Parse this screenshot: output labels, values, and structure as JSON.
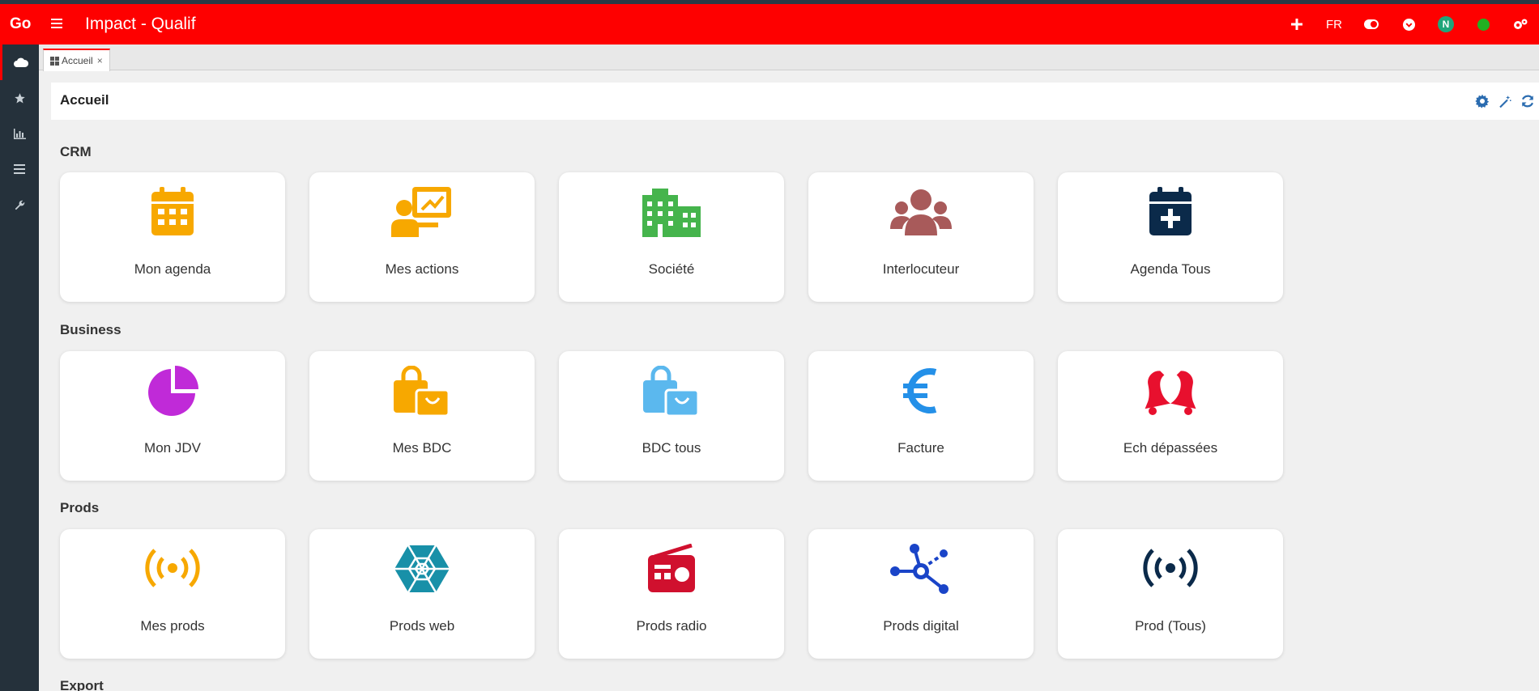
{
  "header": {
    "logo": "Go",
    "title": "Impact - Qualif",
    "language": "FR",
    "avatar_initial": "N",
    "color": "#fe0000"
  },
  "sidebar": {
    "items": [
      {
        "icon": "cloud-icon"
      },
      {
        "icon": "star-icon"
      },
      {
        "icon": "bar-chart-icon"
      },
      {
        "icon": "list-icon"
      },
      {
        "icon": "wrench-icon"
      }
    ]
  },
  "tabs": [
    {
      "label": "Accueil",
      "icon": "grid-icon",
      "close": "×"
    }
  ],
  "page": {
    "title": "Accueil"
  },
  "sections": [
    {
      "title": "CRM",
      "cards": [
        {
          "label": "Mon agenda",
          "icon": "calendar-icon",
          "color": "#f7a800"
        },
        {
          "label": "Mes actions",
          "icon": "presenter-chart-icon",
          "color": "#f7a800"
        },
        {
          "label": "Société",
          "icon": "building-icon",
          "color": "#45b44c"
        },
        {
          "label": "Interlocuteur",
          "icon": "users-icon",
          "color": "#a85a5a"
        },
        {
          "label": "Agenda Tous",
          "icon": "calendar-plus-icon",
          "color": "#0b2a4a"
        }
      ]
    },
    {
      "title": "Business",
      "cards": [
        {
          "label": "Mon JDV",
          "icon": "pie-chart-icon",
          "color": "#c02ad8"
        },
        {
          "label": "Mes BDC",
          "icon": "shopping-bags-icon",
          "color": "#f7a800"
        },
        {
          "label": "BDC tous",
          "icon": "shopping-bags-icon",
          "color": "#5bb8ee"
        },
        {
          "label": "Facture",
          "icon": "euro-icon",
          "color": "#2490e8"
        },
        {
          "label": "Ech dépassées",
          "icon": "bells-icon",
          "color": "#e8102e"
        }
      ]
    },
    {
      "title": "Prods",
      "cards": [
        {
          "label": "Mes prods",
          "icon": "broadcast-icon",
          "color": "#f7a800"
        },
        {
          "label": "Prods web",
          "icon": "spider-web-icon",
          "color": "#1890a8"
        },
        {
          "label": "Prods radio",
          "icon": "radio-icon",
          "color": "#d0102e"
        },
        {
          "label": "Prods digital",
          "icon": "network-icon",
          "color": "#1a44c8"
        },
        {
          "label": "Prod (Tous)",
          "icon": "broadcast-icon",
          "color": "#0b2a4a"
        }
      ]
    },
    {
      "title": "Export",
      "cards": []
    }
  ]
}
